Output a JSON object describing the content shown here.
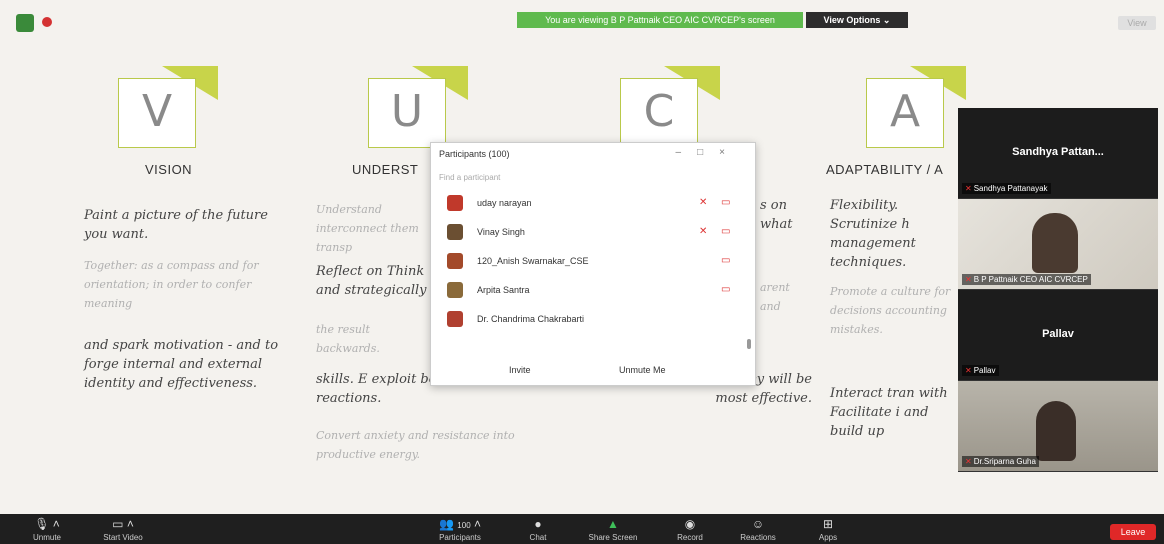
{
  "banner": {
    "viewing_text": "You are viewing B P Pattnaik CEO AIC CVRCEP's screen",
    "view_options": "View Options ⌄",
    "view_btn": "View"
  },
  "logos": [
    "V",
    "U",
    "C",
    "A"
  ],
  "columns": {
    "vision_title": "VISION",
    "vision_text1": "Paint a picture of the future you want.",
    "vision_faint": "Together: as a compass and for orientation; in order to confer meaning",
    "vision_text2": "and spark motivation - and to forge internal and external identity and effectiveness.",
    "under_title": "UNDERST",
    "under_faint1": "Understand interconnect them transp",
    "under_text1": "Reflect on Think and strategically",
    "under_faint2": "the result backwards.",
    "under_text2": "skills. E exploit behaviors and reactions.",
    "under_faint3": "Convert anxiety and resistance into productive energy.",
    "clar_text1": "s on what",
    "clar_faint": "arent and",
    "clar_text2": "force exactly where they will be most effective.",
    "adapt_title": "ADAPTABILITY / A",
    "adapt_text1": "Flexibility. Scrutinize h management techniques.",
    "adapt_faint": "Promote a culture for decisions accounting mistakes.",
    "adapt_text2": "Interact tran with Facilitate i and build up"
  },
  "participants": {
    "title": "Participants (100)",
    "search_placeholder": "Find a participant",
    "rows": [
      {
        "name": "uday narayan"
      },
      {
        "name": "Vinay Singh"
      },
      {
        "name": "120_Anish Swarnakar_CSE"
      },
      {
        "name": "Arpita Santra"
      },
      {
        "name": "Dr. Chandrima Chakrabarti"
      }
    ],
    "invite": "Invite",
    "unmute_me": "Unmute Me"
  },
  "videos": {
    "tile1_name": "Sandhya Pattan...",
    "tile1_label": "Sandhya Pattanayak",
    "tile2_label": "B P Pattnaik CEO AIC CVRCEP",
    "tile3_name": "Pallav",
    "tile3_label": "Pallav",
    "tile4_label": "Dr.Sriparna Guha"
  },
  "toolbar": {
    "unmute": "Unmute",
    "start_video": "Start Video",
    "participants": "Participants",
    "participants_count": "100",
    "chat": "Chat",
    "share_screen": "Share Screen",
    "record": "Record",
    "reactions": "Reactions",
    "apps": "Apps",
    "leave": "Leave"
  }
}
